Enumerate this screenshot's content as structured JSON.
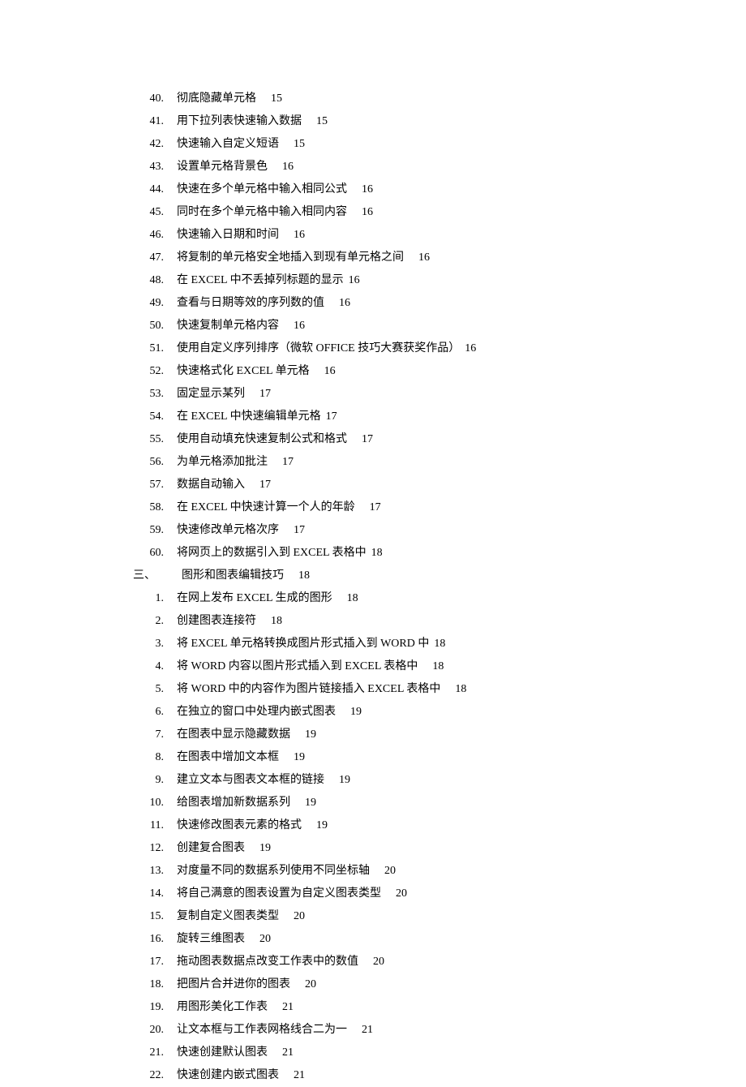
{
  "items": [
    {
      "type": "item",
      "num": "40.",
      "title": "彻底隐藏单元格",
      "page": "15"
    },
    {
      "type": "item",
      "num": "41.",
      "title": "用下拉列表快速输入数据",
      "page": "15"
    },
    {
      "type": "item",
      "num": "42.",
      "title": "快速输入自定义短语",
      "page": "15"
    },
    {
      "type": "item",
      "num": "43.",
      "title": "设置单元格背景色",
      "page": "16"
    },
    {
      "type": "item",
      "num": "44.",
      "title": "快速在多个单元格中输入相同公式",
      "page": "16"
    },
    {
      "type": "item",
      "num": "45.",
      "title": "同时在多个单元格中输入相同内容",
      "page": "16"
    },
    {
      "type": "item",
      "num": "46.",
      "title": "快速输入日期和时间",
      "page": "16"
    },
    {
      "type": "item",
      "num": "47.",
      "title": "将复制的单元格安全地插入到现有单元格之间",
      "page": "16"
    },
    {
      "type": "item",
      "num": "48.",
      "title": "在 EXCEL 中不丢掉列标题的显示",
      "page": "16",
      "tight": true
    },
    {
      "type": "item",
      "num": "49.",
      "title": "查看与日期等效的序列数的值",
      "page": "16"
    },
    {
      "type": "item",
      "num": "50.",
      "title": "快速复制单元格内容",
      "page": "16"
    },
    {
      "type": "item",
      "num": "51.",
      "title": "使用自定义序列排序（微软 OFFICE 技巧大赛获奖作品）",
      "page": "16",
      "tight": true
    },
    {
      "type": "item",
      "num": "52.",
      "title": "快速格式化 EXCEL 单元格",
      "page": "16"
    },
    {
      "type": "item",
      "num": "53.",
      "title": "固定显示某列",
      "page": "17"
    },
    {
      "type": "item",
      "num": "54.",
      "title": "在 EXCEL 中快速编辑单元格",
      "page": "17",
      "tight": true
    },
    {
      "type": "item",
      "num": "55.",
      "title": "使用自动填充快速复制公式和格式",
      "page": "17"
    },
    {
      "type": "item",
      "num": "56.",
      "title": "为单元格添加批注",
      "page": "17"
    },
    {
      "type": "item",
      "num": "57.",
      "title": "数据自动输入",
      "page": "17"
    },
    {
      "type": "item",
      "num": "58.",
      "title": "在 EXCEL 中快速计算一个人的年龄",
      "page": "17"
    },
    {
      "type": "item",
      "num": "59.",
      "title": "快速修改单元格次序",
      "page": "17"
    },
    {
      "type": "item",
      "num": "60.",
      "title": "将网页上的数据引入到 EXCEL 表格中",
      "page": "18",
      "tight": true
    },
    {
      "type": "section",
      "num": "三、",
      "title": "图形和图表编辑技巧",
      "page": "18"
    },
    {
      "type": "item",
      "num": "1.",
      "title": "在网上发布 EXCEL 生成的图形",
      "page": "18"
    },
    {
      "type": "item",
      "num": "2.",
      "title": "创建图表连接符",
      "page": "18"
    },
    {
      "type": "item",
      "num": "3.",
      "title": "将 EXCEL 单元格转换成图片形式插入到 WORD 中",
      "page": "18",
      "tight": true
    },
    {
      "type": "item",
      "num": "4.",
      "title": "将 WORD 内容以图片形式插入到 EXCEL 表格中",
      "page": "18"
    },
    {
      "type": "item",
      "num": "5.",
      "title": "将 WORD 中的内容作为图片链接插入 EXCEL 表格中",
      "page": "18"
    },
    {
      "type": "item",
      "num": "6.",
      "title": "在独立的窗口中处理内嵌式图表",
      "page": "19"
    },
    {
      "type": "item",
      "num": "7.",
      "title": "在图表中显示隐藏数据",
      "page": "19"
    },
    {
      "type": "item",
      "num": "8.",
      "title": "在图表中增加文本框",
      "page": "19"
    },
    {
      "type": "item",
      "num": "9.",
      "title": "建立文本与图表文本框的链接",
      "page": "19"
    },
    {
      "type": "item",
      "num": "10.",
      "title": "给图表增加新数据系列",
      "page": "19"
    },
    {
      "type": "item",
      "num": "11.",
      "title": "快速修改图表元素的格式",
      "page": "19"
    },
    {
      "type": "item",
      "num": "12.",
      "title": "创建复合图表",
      "page": "19"
    },
    {
      "type": "item",
      "num": "13.",
      "title": "对度量不同的数据系列使用不同坐标轴",
      "page": "20"
    },
    {
      "type": "item",
      "num": "14.",
      "title": "将自己满意的图表设置为自定义图表类型",
      "page": "20"
    },
    {
      "type": "item",
      "num": "15.",
      "title": "复制自定义图表类型",
      "page": "20"
    },
    {
      "type": "item",
      "num": "16.",
      "title": "旋转三维图表",
      "page": "20"
    },
    {
      "type": "item",
      "num": "17.",
      "title": "拖动图表数据点改变工作表中的数值",
      "page": "20"
    },
    {
      "type": "item",
      "num": "18.",
      "title": "把图片合并进你的图表",
      "page": "20"
    },
    {
      "type": "item",
      "num": "19.",
      "title": "用图形美化工作表",
      "page": "21"
    },
    {
      "type": "item",
      "num": "20.",
      "title": "让文本框与工作表网格线合二为一",
      "page": "21"
    },
    {
      "type": "item",
      "num": "21.",
      "title": "快速创建默认图表",
      "page": "21"
    },
    {
      "type": "item",
      "num": "22.",
      "title": "快速创建内嵌式图表",
      "page": "21"
    }
  ]
}
